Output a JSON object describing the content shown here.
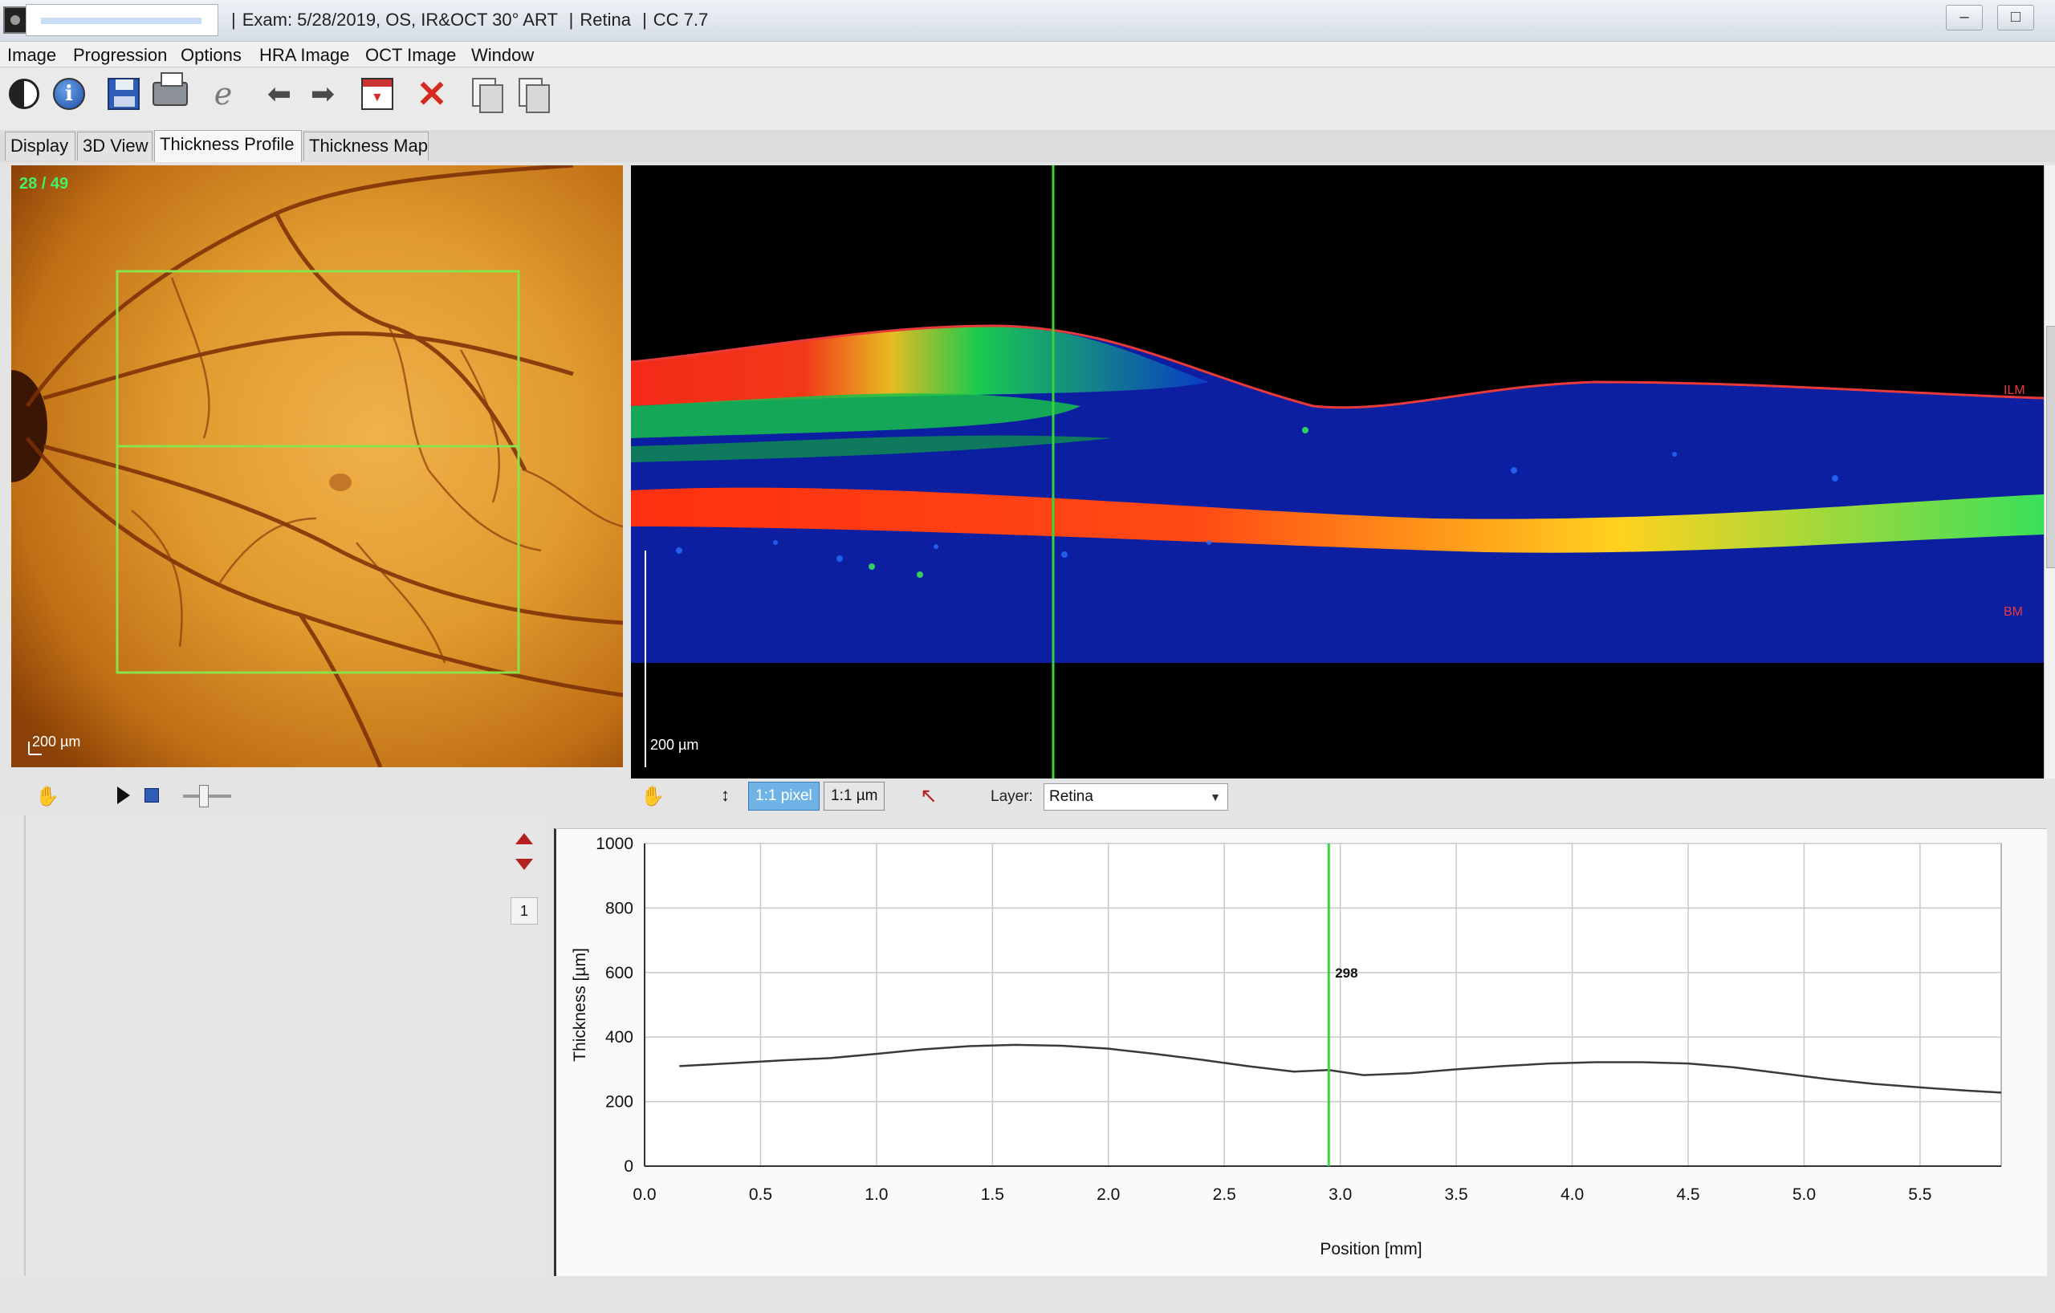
{
  "window": {
    "title_parts": [
      "Exam: 5/28/2019, OS, IR&OCT 30° ART",
      "Retina",
      "CC 7.7"
    ],
    "controls": [
      "‒",
      "□"
    ]
  },
  "menu": [
    "Image",
    "Progression",
    "Options",
    "HRA Image",
    "OCT Image",
    "Window"
  ],
  "toolbar_icons": [
    "contrast-icon",
    "info-icon",
    "save-icon",
    "print-icon",
    "edit-icon",
    "back-arrow-icon",
    "forward-arrow-icon",
    "report-icon",
    "delete-icon",
    "copy-icon",
    "paste-icon"
  ],
  "tabs": [
    {
      "label": "Display",
      "active": false
    },
    {
      "label": "3D View",
      "active": false
    },
    {
      "label": "Thickness Profile",
      "active": true
    },
    {
      "label": "Thickness Map",
      "active": false
    }
  ],
  "fundus": {
    "scan_counter": "28 / 49",
    "scale_label": "200 µm"
  },
  "oct": {
    "scale_label": "200 µm",
    "ilm_label": "ILM",
    "bm_label": "BM"
  },
  "oct_controls": {
    "pixel_button": "1:1 pixel",
    "um_button": "1:1 µm",
    "layer_label": "Layer:",
    "layer_value": "Retina"
  },
  "page_indicator": "1",
  "colors": {
    "marker": "#37d43a",
    "ilm": "#e83a3a",
    "profile": "#3a3a3a",
    "active_button": "#6fb2e6"
  },
  "chart_data": {
    "type": "line",
    "xlabel": "Position [mm]",
    "ylabel": "Thickness [µm]",
    "xlim": [
      0.0,
      5.85
    ],
    "ylim": [
      0,
      1000
    ],
    "x_ticks": [
      0.0,
      0.5,
      1.0,
      1.5,
      2.0,
      2.5,
      3.0,
      3.5,
      4.0,
      4.5,
      5.0,
      5.5
    ],
    "x_tick_labels": [
      "0.0",
      "0.5",
      "1.0",
      "1.5",
      "2.0",
      "2.5",
      "3.0",
      "3.5",
      "4.0",
      "4.5",
      "5.0",
      "5.5"
    ],
    "y_ticks": [
      0,
      200,
      400,
      600,
      800,
      1000
    ],
    "y_tick_labels": [
      "0",
      "200",
      "400",
      "600",
      "800",
      "1000"
    ],
    "grid": true,
    "marker": {
      "x": 2.95,
      "label": "298"
    },
    "series": [
      {
        "x": [
          0.15,
          0.4,
          0.6,
          0.8,
          1.0,
          1.2,
          1.4,
          1.6,
          1.8,
          2.0,
          2.2,
          2.4,
          2.6,
          2.8,
          2.95,
          3.1,
          3.3,
          3.5,
          3.7,
          3.9,
          4.1,
          4.3,
          4.5,
          4.7,
          4.9,
          5.1,
          5.3,
          5.5,
          5.7,
          5.85
        ],
        "y": [
          310,
          320,
          328,
          335,
          348,
          362,
          372,
          376,
          373,
          364,
          348,
          330,
          310,
          293,
          298,
          282,
          288,
          300,
          310,
          318,
          322,
          322,
          318,
          306,
          288,
          270,
          255,
          244,
          234,
          228
        ]
      }
    ]
  }
}
